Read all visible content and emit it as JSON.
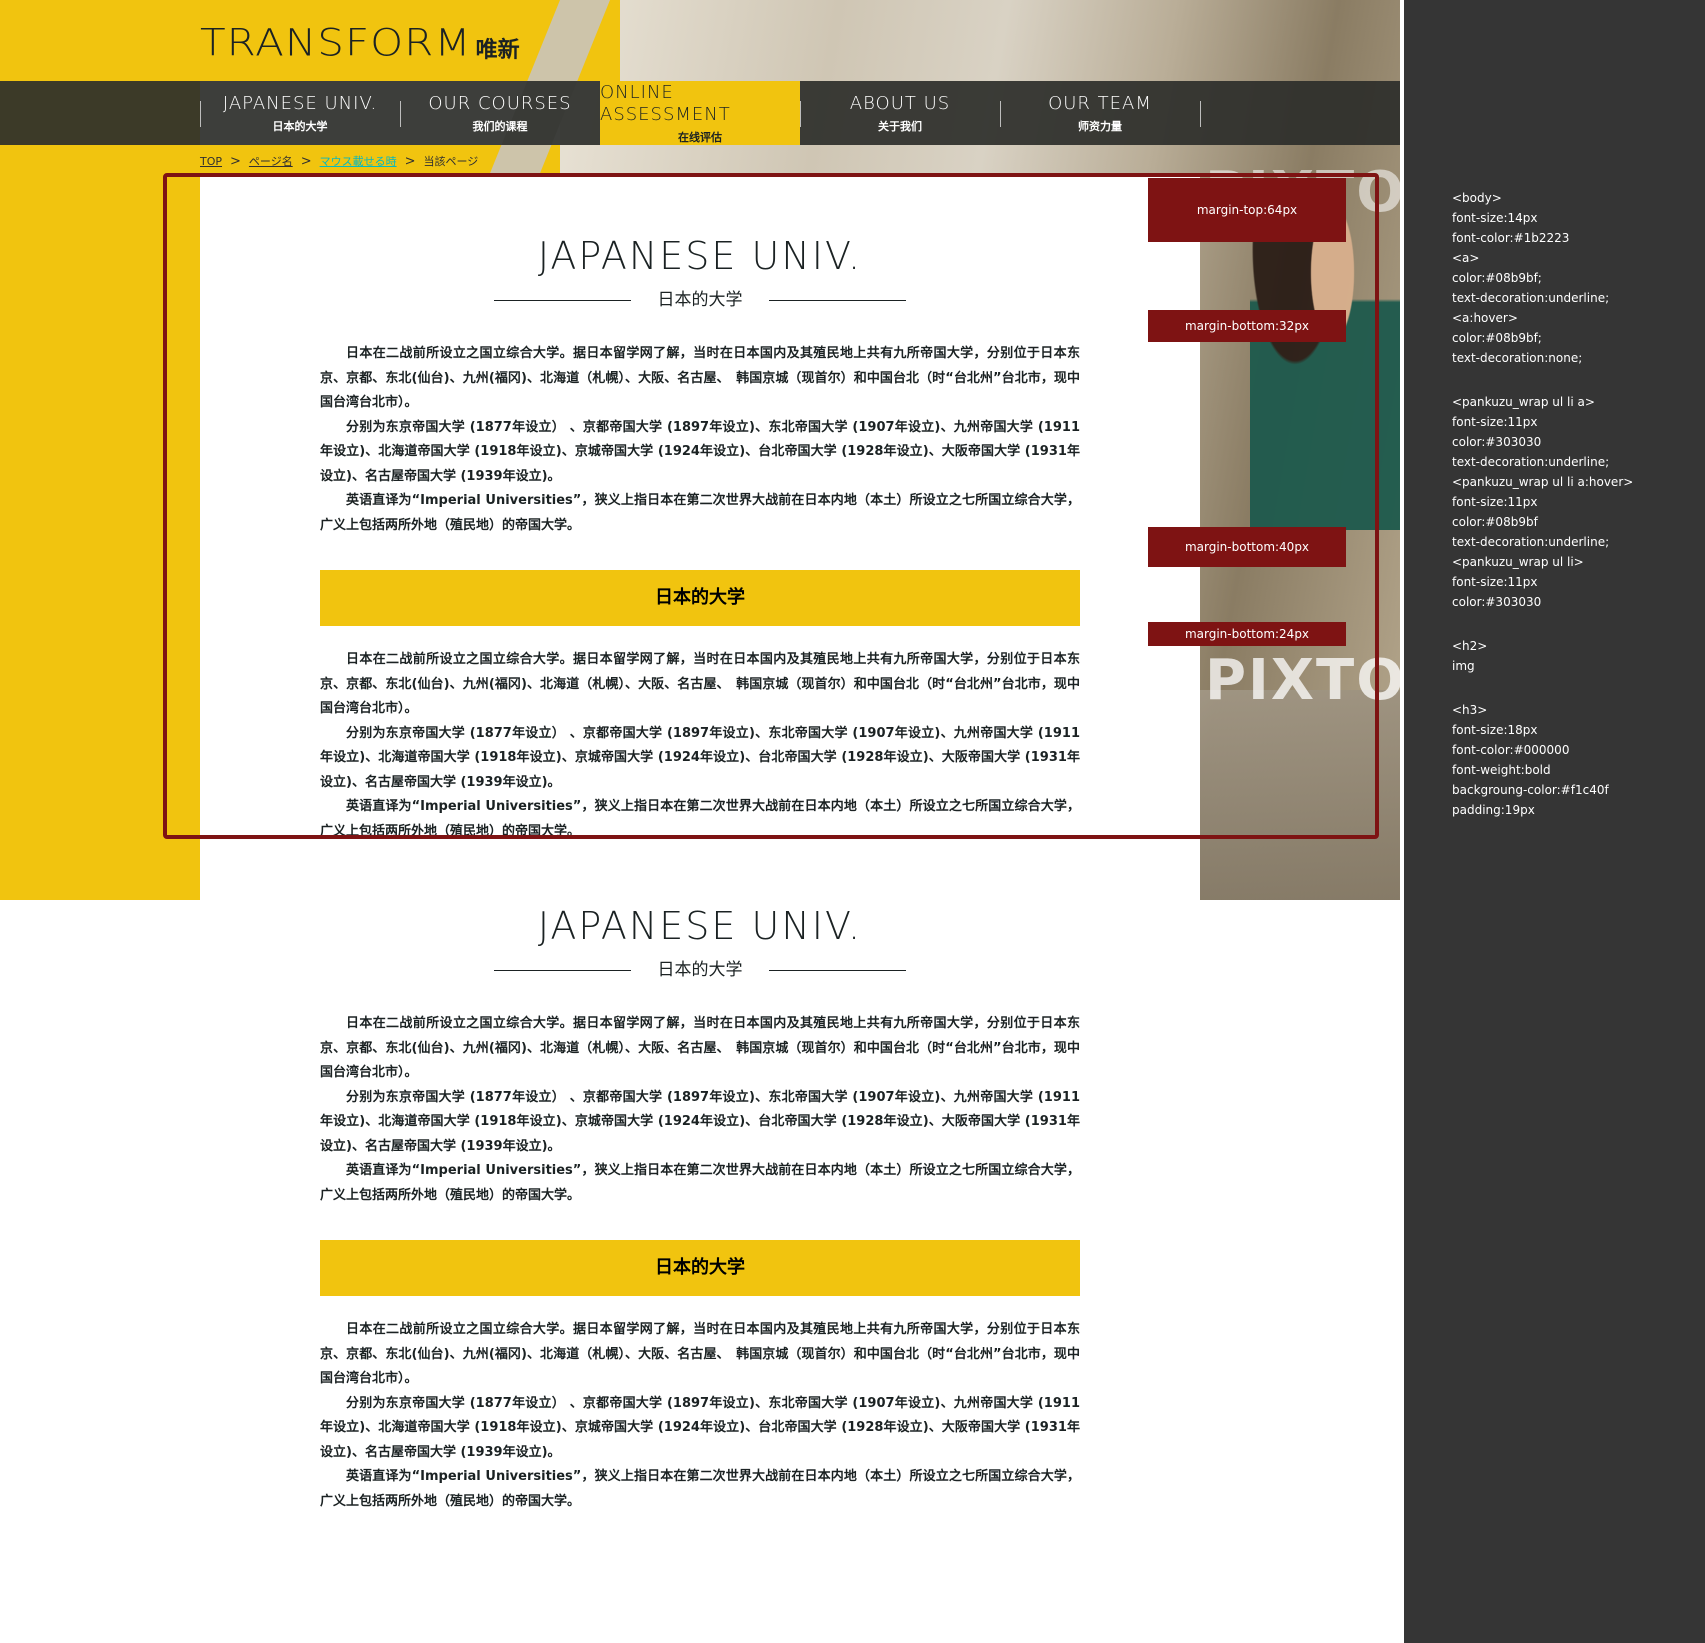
{
  "logo": {
    "text": "TRANSFORM",
    "sub": "唯新"
  },
  "nav": {
    "items": [
      {
        "en": "JAPANESE UNIV.",
        "zh": "日本的大学",
        "active": false
      },
      {
        "en": "OUR COURSES",
        "zh": "我们的课程",
        "active": false
      },
      {
        "en": "ONLINE ASSESSMENT",
        "zh": "在线评估",
        "active": true
      },
      {
        "en": "ABOUT US",
        "zh": "关于我们",
        "active": false
      },
      {
        "en": "OUR TEAM",
        "zh": "师资力量",
        "active": false
      }
    ]
  },
  "breadcrumb": {
    "items": [
      "TOP",
      "ページ名",
      "マウス載せる時",
      "当該ページ"
    ],
    "separator": ">"
  },
  "photo": {
    "watermark": "PIXTO"
  },
  "section": {
    "title": "JAPANESE UNIV.",
    "subtitle": "日本的大学",
    "paragraphs": [
      "日本在二战前所设立之国立综合大学。据日本留学网了解，当时在日本国内及其殖民地上共有九所帝国大学，分别位于日本东京、京都、东北(仙台)、九州(福冈)、北海道（札幌）、大阪、名古屋、　韩国京城（现首尔）和中国台北（时“台北州”台北市，现中国台湾台北市）。",
      "分别为东京帝国大学 (1877年设立） 、京都帝国大学 (1897年设立)、东北帝国大学 (1907年设立)、九州帝国大学 (1911年设立)、北海道帝国大学 (1918年设立)、京城帝国大学 (1924年设立)、台北帝国大学 (1928年设立)、大阪帝国大学 (1931年设立)、名古屋帝国大学 (1939年设立)。",
      "英语直译为“Imperial Universities”，狭义上指日本在第二次世界大战前在日本内地（本土）所设立之七所国立综合大学，广义上包括两所外地（殖民地）的帝国大学。"
    ],
    "h3": "日本的大学"
  },
  "annotations": {
    "margin_top": "margin-top:64px",
    "margin_bottom_1": "margin-bottom:32px",
    "margin_bottom_2": "margin-bottom:40px",
    "margin_bottom_3": "margin-bottom:24px",
    "frame_color": "#7e1313"
  },
  "style_notes": [
    [
      "<body>",
      "font-size:14px",
      "font-color:#1b2223",
      "<a>",
      "color:#08b9bf;",
      "text-decoration:underline;",
      "<a:hover>",
      "color:#08b9bf;",
      "text-decoration:none;"
    ],
    [
      "<pankuzu_wrap ul li a>",
      "font-size:11px",
      "color:#303030",
      "text-decoration:underline;",
      "<pankuzu_wrap ul li a:hover>",
      "font-size:11px",
      "color:#08b9bf",
      "text-decoration:underline;",
      "<pankuzu_wrap ul li>",
      "font-size:11px",
      "color:#303030"
    ],
    [
      "<h2>",
      "img"
    ],
    [
      "<h3>",
      "font-size:18px",
      "font-color:#000000",
      "font-weight:bold",
      "backgroung-color:#f1c40f",
      "padding:19px"
    ]
  ],
  "colors": {
    "accent": "#f1c40f",
    "text": "#1b2223",
    "link": "#08b9bf",
    "nav_bg": "#2c2e2a",
    "panel_bg": "#353535"
  }
}
